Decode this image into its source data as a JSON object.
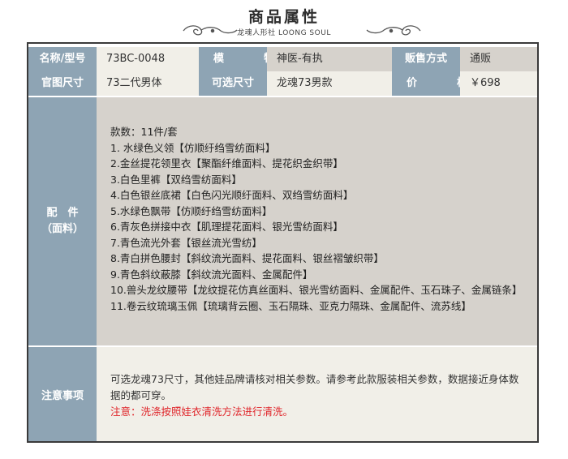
{
  "header": {
    "title": "商品属性",
    "brand": "龙魂人形社 LOONG SOUL"
  },
  "specs": {
    "row1": [
      {
        "label": "名称/型号",
        "value": "73BC-0048"
      },
      {
        "label": "模　特",
        "value": "神医-有执"
      },
      {
        "label": "贩售方式",
        "value": "通贩"
      }
    ],
    "row2": [
      {
        "label": "官图尺寸",
        "value": "73二代男体"
      },
      {
        "label": "可选尺寸",
        "value": "龙魂73男款"
      },
      {
        "label": "价　格",
        "value": "￥698"
      }
    ]
  },
  "accessories": {
    "label_line1": "配　件",
    "label_line2": "（面料）",
    "count": "款数：11件/套",
    "items": [
      "1. 水绿色义领【仿顺纡绉雪纺面料】",
      "2.金丝提花领里衣【聚酯纤维面料、提花织金织带】",
      "3.白色里裤【双绉雪纺面料】",
      "4.白色银丝底裙【白色闪光顺纡面料、双绉雪纺面料】",
      "5.水绿色飘带【仿顺纡绉雪纺面料】",
      "6.青灰色拼接中衣【肌理提花面料、银光雪纺面料】",
      "7.青色流光外套【银丝流光雪纺】",
      "8.青白拼色腰封【斜纹流光面料、提花面料、银丝褶皱织带】",
      "9.青色斜纹蔽膝【斜纹流光面料、金属配件】",
      "10.兽头龙纹腰带【龙纹提花仿真丝面料、银光雪纺面料、金属配件、玉石珠子、金属链条】",
      "11.卷云纹琉璃玉佩【琉璃背云圈、玉石隔珠、亚克力隔珠、金属配件、流苏线】"
    ]
  },
  "notes": {
    "label": "注意事项",
    "text": "可选龙魂73尺寸，其他娃品牌请核对相关参数。请参考此款服装相关参数，数据接近身体数据的都可穿。",
    "warning": "注意：洗涤按照娃衣清洗方法进行清洗。"
  },
  "colors": {
    "label_bg": "#8ea4b4",
    "value_light": "#f1efe8",
    "value_dark": "#d6d2cc",
    "warning": "#e0252a",
    "border": "#3a3a3a"
  }
}
